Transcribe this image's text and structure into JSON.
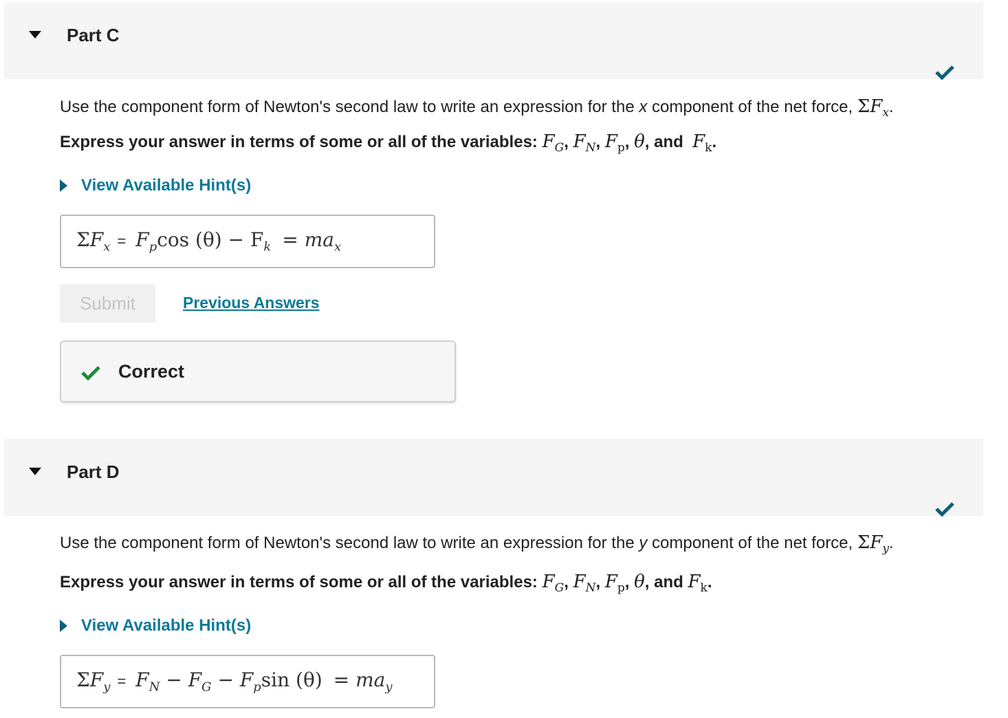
{
  "part_c": {
    "title": "Part C",
    "prompt_pre": "Use the component form of Newton's second law to write an expression for the ",
    "prompt_var": "x",
    "prompt_post": " component of the net force, ",
    "prompt_expr_sigma": "ΣF",
    "prompt_expr_sub": "x",
    "prompt_end": ".",
    "instruction_label": "Express your answer in terms of some or all of the variables: ",
    "variables": [
      "F",
      "G",
      "F",
      "N",
      "F",
      "p",
      "θ",
      "F",
      "k"
    ],
    "and_text": "and",
    "hint_label": "View Available Hint(s)",
    "answer_lhs": "ΣF",
    "answer_lhs_sub": "x",
    "answer_eq": "=",
    "answer_expr_a": "F",
    "answer_expr_a_sub": "p",
    "answer_expr_b": "cos (θ) − F",
    "answer_expr_b_sub": "k",
    "answer_rhs": "= ma",
    "answer_rhs_sub": "x",
    "submit_label": "Submit",
    "previous_label": "Previous Answers",
    "feedback_label": "Correct"
  },
  "part_d": {
    "title": "Part D",
    "prompt_pre": "Use the component form of Newton's second law to write an expression for the ",
    "prompt_var": "y",
    "prompt_post": " component of the net force, ",
    "prompt_expr_sigma": "ΣF",
    "prompt_expr_sub": "y",
    "prompt_end": ".",
    "instruction_label": "Express your answer in terms of some or all of the variables: ",
    "and_text": "and",
    "hint_label": "View Available Hint(s)",
    "answer_lhs": "ΣF",
    "answer_lhs_sub": "y",
    "answer_eq": "=",
    "answer_expr_1": "F",
    "answer_expr_1_sub": "N",
    "answer_expr_2": " − F",
    "answer_expr_2_sub": "G",
    "answer_expr_3": " − F",
    "answer_expr_3_sub": "p",
    "answer_expr_4": "sin (θ)",
    "answer_rhs": "= ma",
    "answer_rhs_sub": "y"
  },
  "colors": {
    "accent": "#0b7a99",
    "check_dark": "#0b5f7a",
    "check_green": "#1e8a3c",
    "header_bg": "#f5f5f5"
  },
  "icons": [
    "caret-down-icon",
    "checkmark-icon",
    "caret-right-icon",
    "correct-check-icon"
  ]
}
